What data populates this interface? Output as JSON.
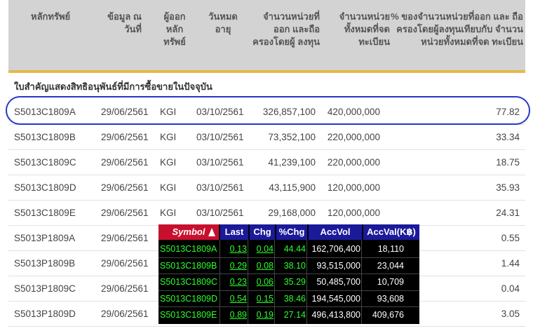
{
  "headers": {
    "security": "หลักทรัพย์",
    "data_as_of": "ข้อมูล ณ วันที่",
    "issuer": "ผู้ออก หลัก ทรัพย์",
    "expiry": "วันหมด อายุ",
    "units_held": "จำนวนหน่วยที่ ออก และถือ ครองโดยผู้ ลงทุน",
    "units_registered": "จำนวนหน่วย ทั้งหมดที่จด ทะเบียน",
    "percent_held": "% ของจำนวนหน่วยที่ออก และ ถือครองโดยผู้ลงทุนเทียบกับ จำนวนหน่วยทั้งหมดที่จด ทะเบียน"
  },
  "section_title": "ใบสำคัญแสดงสิทธิอนุพันธ์ที่มีการซื้อขายในปัจจุบัน",
  "rows": [
    {
      "symbol": "S5013C1809A",
      "date": "29/06/2561",
      "issuer": "KGI",
      "expiry": "03/10/2561",
      "held": "326,857,100",
      "registered": "420,000,000",
      "percent": "77.82"
    },
    {
      "symbol": "S5013C1809B",
      "date": "29/06/2561",
      "issuer": "KGI",
      "expiry": "03/10/2561",
      "held": "73,352,100",
      "registered": "220,000,000",
      "percent": "33.34"
    },
    {
      "symbol": "S5013C1809C",
      "date": "29/06/2561",
      "issuer": "KGI",
      "expiry": "03/10/2561",
      "held": "41,239,100",
      "registered": "220,000,000",
      "percent": "18.75"
    },
    {
      "symbol": "S5013C1809D",
      "date": "29/06/2561",
      "issuer": "KGI",
      "expiry": "03/10/2561",
      "held": "43,115,900",
      "registered": "120,000,000",
      "percent": "35.93"
    },
    {
      "symbol": "S5013C1809E",
      "date": "29/06/2561",
      "issuer": "KGI",
      "expiry": "03/10/2561",
      "held": "29,168,000",
      "registered": "120,000,000",
      "percent": "24.31"
    },
    {
      "symbol": "S5013P1809A",
      "date": "29/06/2561",
      "issuer": "",
      "expiry": "",
      "held": "",
      "registered": "",
      "percent": "0.55"
    },
    {
      "symbol": "S5013P1809B",
      "date": "29/06/2561",
      "issuer": "",
      "expiry": "",
      "held": "",
      "registered": "",
      "percent": "1.44"
    },
    {
      "symbol": "S5013P1809C",
      "date": "29/06/2561",
      "issuer": "",
      "expiry": "",
      "held": "",
      "registered": "",
      "percent": "0.04"
    },
    {
      "symbol": "S5013P1809D",
      "date": "29/06/2561",
      "issuer": "",
      "expiry": "",
      "held": "",
      "registered": "",
      "percent": "3.05"
    }
  ],
  "ticker": {
    "headers": {
      "symbol": "Symbol",
      "last": "Last",
      "chg": "Chg",
      "pchg": "%Chg",
      "accvol": "AccVol",
      "accval": "AccVal(K฿)"
    },
    "rows": [
      {
        "symbol": "S5013C1809A",
        "last": "0.13",
        "chg": "0.04",
        "pchg": "44.44",
        "accvol": "162,706,400",
        "accval": "18,110"
      },
      {
        "symbol": "S5013C1809B",
        "last": "0.29",
        "chg": "0.08",
        "pchg": "38.10",
        "accvol": "93,515,000",
        "accval": "23,044"
      },
      {
        "symbol": "S5013C1809C",
        "last": "0.23",
        "chg": "0.06",
        "pchg": "35.29",
        "accvol": "50,485,700",
        "accval": "10,709"
      },
      {
        "symbol": "S5013C1809D",
        "last": "0.54",
        "chg": "0.15",
        "pchg": "38.46",
        "accvol": "194,545,000",
        "accval": "93,608"
      },
      {
        "symbol": "S5013C1809E",
        "last": "0.89",
        "chg": "0.19",
        "pchg": "27.14",
        "accvol": "496,413,800",
        "accval": "409,676"
      }
    ]
  },
  "colors": {
    "header_bg": "#d3d3d3",
    "header_accent": "#e6b84a",
    "highlight": "#2a37c4",
    "ticker_header": "#1a1a9a",
    "ticker_symbol_header": "#c8102e",
    "ticker_green": "#2cff2c"
  }
}
